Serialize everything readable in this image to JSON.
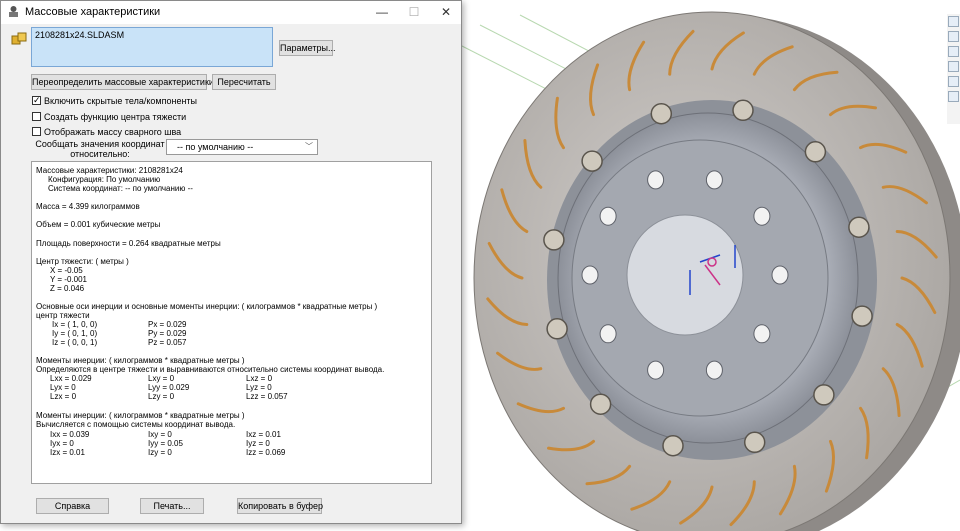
{
  "window": {
    "title": "Массовые характеристики",
    "minimize_glyph": "—",
    "maximize_glyph": "☐",
    "close_glyph": "✕"
  },
  "selection": {
    "file": "2108281x24.SLDASM"
  },
  "buttons": {
    "params": "Параметры...",
    "override": "Переопределить массовые характеристики...",
    "recalc": "Пересчитать",
    "help": "Справка",
    "print": "Печать...",
    "copy": "Копировать в буфер"
  },
  "options": [
    {
      "label": "Включить скрытые тела/компоненты",
      "checked": true
    },
    {
      "label": "Создать функцию центра тяжести",
      "checked": false
    },
    {
      "label": "Отображать массу сварного шва",
      "checked": false
    }
  ],
  "coord_system": {
    "label_line1": "Сообщать значения координат",
    "label_line2": "относительно:",
    "value": "-- по умолчанию --"
  },
  "results": {
    "header": "Массовые характеристики: 2108281x24",
    "config": "Конфигурация: По умолчанию",
    "coord_sys": "Система координат: -- по умолчанию --",
    "mass": "Масса = 4.399 килограммов",
    "volume": "Объем = 0.001 кубические метры",
    "area": "Площадь поверхности = 0.264 квадратные метры",
    "cog_title": "Центр тяжести: ( метры )",
    "cog_x": "X = -0.05",
    "cog_y": "Y = -0.001",
    "cog_z": "Z = 0.046",
    "principal_title": "Основные оси инерции и основные моменты инерции: ( килограммов * квадратные метры )",
    "principal_sub": "центр тяжести",
    "axes": [
      {
        "axis": "Ix = ( 1,  0,  0)",
        "moment": "Px = 0.029"
      },
      {
        "axis": "Iy = ( 0,  1,  0)",
        "moment": "Py = 0.029"
      },
      {
        "axis": "Iz = ( 0,  0,  1)",
        "moment": "Pz = 0.057"
      }
    ],
    "moments_cog_title": "Моменты инерции: ( килограммов * квадратные метры )",
    "moments_cog_sub": "Определяются в центре тяжести и выравниваются относительно системы координат вывода.",
    "moments_cog": [
      [
        "Lxx = 0.029",
        "Lxy = 0",
        "Lxz = 0"
      ],
      [
        "Lyx = 0",
        "Lyy = 0.029",
        "Lyz = 0"
      ],
      [
        "Lzx = 0",
        "Lzy = 0",
        "Lzz = 0.057"
      ]
    ],
    "moments_out_title": "Моменты инерции: ( килограммов * квадратные метры )",
    "moments_out_sub": "Вычисляется с помощью системы координат вывода.",
    "moments_out": [
      [
        "Ixx = 0.039",
        "Ixy = 0",
        "Ixz = 0.01"
      ],
      [
        "Iyx = 0",
        "Iyy = 0.05",
        "Iyz = 0"
      ],
      [
        "Izx = 0.01",
        "Izy = 0",
        "Izz = 0.069"
      ]
    ]
  },
  "colors": {
    "disc": "#b7b3af",
    "hub": "#9fa2ab",
    "slot": "#c88a3a",
    "selection_bg": "#c9e3f8"
  }
}
